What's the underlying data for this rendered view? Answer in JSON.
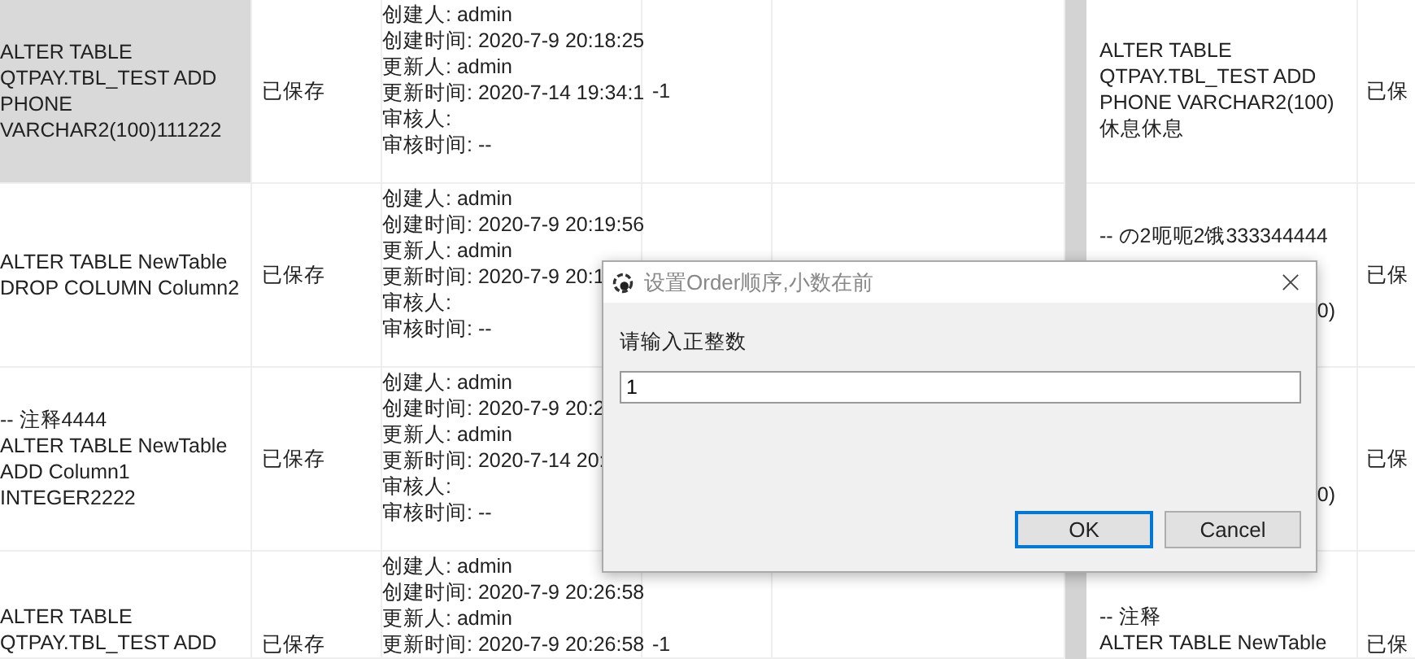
{
  "rows": [
    {
      "selected": true,
      "sql_lines": [
        {
          "kind": "line",
          "text": "ALTER TABLE"
        },
        {
          "kind": "line",
          "text": "QTPAY.TBL_TEST ADD"
        },
        {
          "kind": "line",
          "text": "PHONE"
        },
        {
          "kind": "line",
          "text": "VARCHAR2(100)111222"
        }
      ],
      "status": "已保存",
      "info_lines": [
        "创建人: admin",
        "创建时间: 2020-7-9 20:18:25",
        "更新人: admin",
        "更新时间: 2020-7-14 19:34:1",
        "审核人:",
        "审核时间: --"
      ],
      "column_4": "-1",
      "right_sql_lines": [
        {
          "kind": "line",
          "text": "ALTER TABLE"
        },
        {
          "kind": "line",
          "text": "QTPAY.TBL_TEST ADD"
        },
        {
          "kind": "line",
          "text": "PHONE VARCHAR2(100)"
        },
        {
          "kind": "line",
          "text": "休息休息"
        }
      ],
      "right_status": "已保"
    },
    {
      "selected": false,
      "sql_lines": [
        {
          "kind": "line",
          "text": "ALTER TABLE NewTable"
        },
        {
          "kind": "line",
          "text": "DROP COLUMN Column2"
        }
      ],
      "status": "已保存",
      "info_lines": [
        "创建人: admin",
        "创建时间: 2020-7-9 20:19:56",
        "更新人: admin",
        "更新时间: 2020-7-9 20:1",
        "审核人:",
        "审核时间: --"
      ],
      "right_sql_lines": [
        {
          "kind": "line",
          "text": "-- の2呃呃2饿333344444"
        },
        {
          "kind": "tail",
          "text": "0)"
        }
      ],
      "right_status": "已保"
    },
    {
      "selected": false,
      "sql_lines": [
        {
          "kind": "line",
          "text": "-- 注释4444"
        },
        {
          "kind": "line",
          "text": "ALTER TABLE NewTable"
        },
        {
          "kind": "line",
          "text": "ADD Column1"
        },
        {
          "kind": "line",
          "text": "INTEGER2222"
        }
      ],
      "status": "已保存",
      "info_lines": [
        "创建人: admin",
        "创建时间: 2020-7-9 20:2",
        "更新人: admin",
        "更新时间: 2020-7-14 20:",
        "审核人:",
        "审核时间: --"
      ],
      "right_sql_lines": [
        {
          "kind": "tail",
          "text": "0)"
        }
      ],
      "right_status": "已保"
    },
    {
      "selected": false,
      "sql_lines": [
        {
          "kind": "line",
          "text": "ALTER TABLE"
        },
        {
          "kind": "line",
          "text": "QTPAY.TBL_TEST ADD"
        }
      ],
      "status": "已保存",
      "info_lines": [
        "创建人: admin",
        "创建时间: 2020-7-9 20:26:58",
        "更新人: admin",
        "更新时间: 2020-7-9 20:26:58"
      ],
      "column_4": "-1",
      "right_sql_lines": [
        {
          "kind": "line",
          "text": "-- 注释"
        },
        {
          "kind": "line",
          "text": "ALTER TABLE NewTable"
        }
      ],
      "right_status": "已保"
    }
  ],
  "dialog": {
    "title": "设置Order顺序,小数在前",
    "prompt": "请输入正整数",
    "value": "1",
    "buttons": [
      {
        "label": "OK",
        "default": true
      },
      {
        "label": "Cancel",
        "default": false
      }
    ]
  }
}
